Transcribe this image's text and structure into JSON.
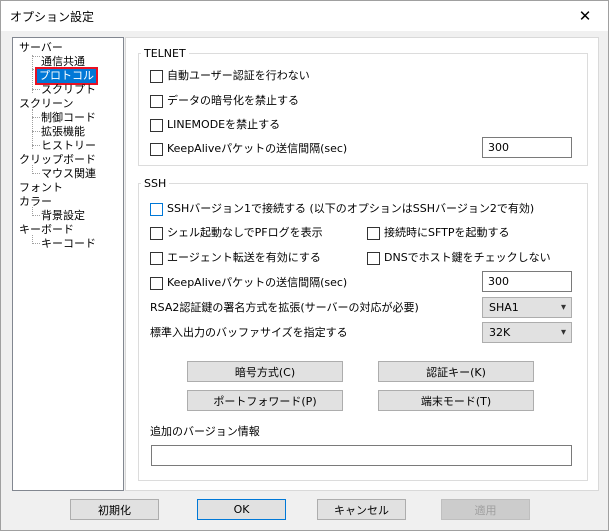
{
  "window": {
    "title": "オプション設定"
  },
  "tree": {
    "items": [
      {
        "label": "サーバー",
        "level": 0
      },
      {
        "label": "通信共通",
        "level": 1
      },
      {
        "label": "プロトコル",
        "level": 1,
        "selected": true
      },
      {
        "label": "スクリプト",
        "level": 1
      },
      {
        "label": "スクリーン",
        "level": 0
      },
      {
        "label": "制御コード",
        "level": 1
      },
      {
        "label": "拡張機能",
        "level": 1
      },
      {
        "label": "ヒストリー",
        "level": 1
      },
      {
        "label": "クリップボード",
        "level": 0
      },
      {
        "label": "マウス関連",
        "level": 1
      },
      {
        "label": "フォント",
        "level": 0
      },
      {
        "label": "カラー",
        "level": 0
      },
      {
        "label": "背景設定",
        "level": 1
      },
      {
        "label": "キーボード",
        "level": 0
      },
      {
        "label": "キーコード",
        "level": 1
      }
    ]
  },
  "telnet": {
    "title": "TELNET",
    "no_auto_auth": "自動ユーザー認証を行わない",
    "no_encrypt": "データの暗号化を禁止する",
    "no_linemode": "LINEMODEを禁止する",
    "keepalive": "KeepAliveパケットの送信間隔(sec)",
    "keepalive_value": "300"
  },
  "ssh": {
    "title": "SSH",
    "ssh1": "SSHバージョン1で接続する (以下のオプションはSSHバージョン2で有効)",
    "no_pty_log": "シェル起動なしでPFログを表示",
    "sftp_on_connect": "接続時にSFTPを起動する",
    "agent_forward": "エージェント転送を有効にする",
    "dns_hostkey": "DNSでホスト鍵をチェックしない",
    "keepalive": "KeepAliveパケットの送信間隔(sec)",
    "keepalive_value": "300",
    "rsa_sig_label": "RSA2認証鍵の署名方式を拡張(サーバーの対応が必要)",
    "rsa_sig_value": "SHA1",
    "buffer_label": "標準入出力のバッファサイズを指定する",
    "buffer_value": "32K",
    "cipher_button": "暗号方式(C)",
    "auth_key_button": "認証キー(K)",
    "port_forward_button": "ポートフォワード(P)",
    "terminal_mode_button": "端末モード(T)",
    "version_info_label": "追加のバージョン情報",
    "version_info_value": ""
  },
  "footer": {
    "reset": "初期化",
    "ok": "OK",
    "cancel": "キャンセル",
    "apply": "適用"
  }
}
